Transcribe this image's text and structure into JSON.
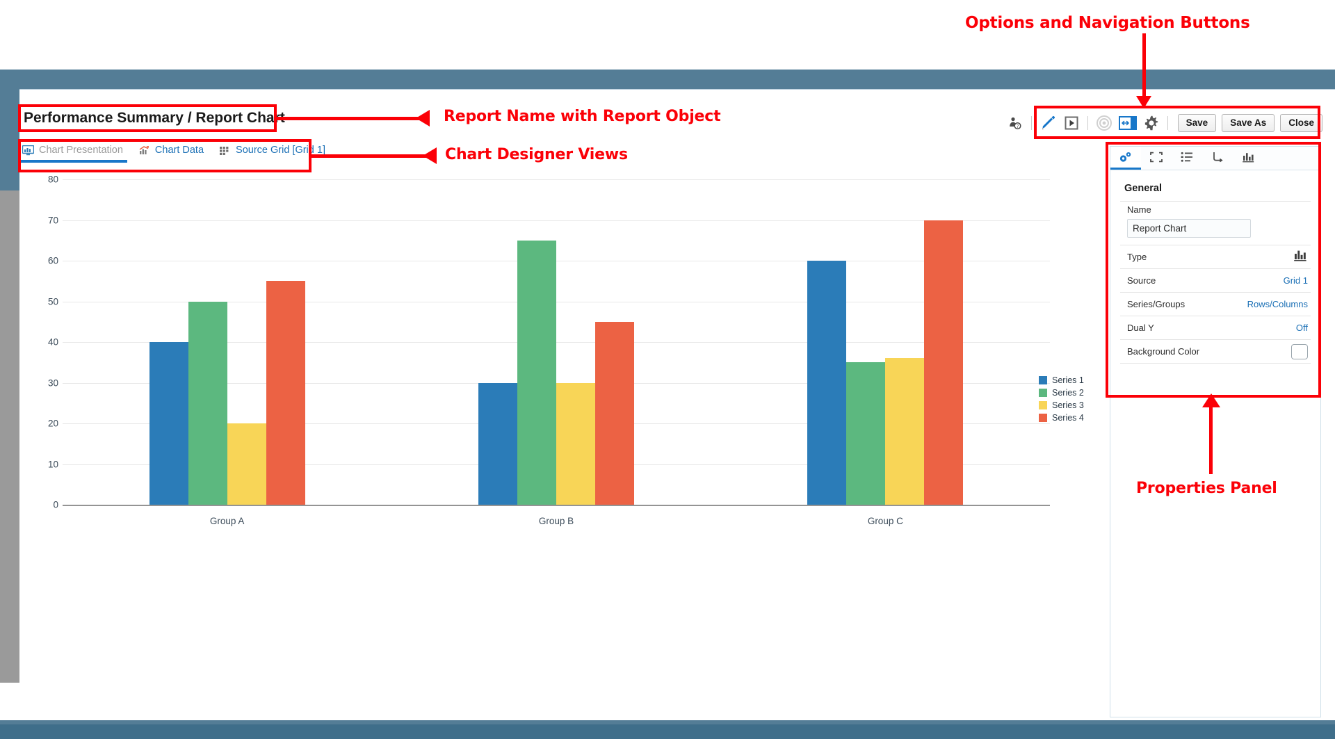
{
  "report": {
    "title": "Performance Summary / Report Chart"
  },
  "view_tabs": [
    {
      "label": "Chart Presentation",
      "icon": "chart-presentation-icon",
      "active": true
    },
    {
      "label": "Chart Data",
      "icon": "chart-data-icon",
      "active": false
    },
    {
      "label": "Source Grid [Grid 1]",
      "icon": "source-grid-icon",
      "active": false
    }
  ],
  "toolbar": {
    "icons": [
      {
        "name": "user-permissions-icon"
      },
      {
        "name": "edit-pencil-icon"
      },
      {
        "name": "run-play-icon"
      },
      {
        "name": "record-target-icon"
      },
      {
        "name": "resize-width-icon"
      },
      {
        "name": "settings-gear-icon"
      }
    ],
    "save_label": "Save",
    "save_as_label": "Save As",
    "close_label": "Close"
  },
  "properties": {
    "tabs": [
      {
        "name": "general-properties-tab",
        "icon": "gears-icon",
        "active": true
      },
      {
        "name": "layout-properties-tab",
        "icon": "expand-brackets-icon",
        "active": false
      },
      {
        "name": "legend-properties-tab",
        "icon": "list-icon",
        "active": false
      },
      {
        "name": "axis-properties-tab",
        "icon": "axis-arrow-icon",
        "active": false
      },
      {
        "name": "series-properties-tab",
        "icon": "bar-chart-icon",
        "active": false
      }
    ],
    "section_title": "General",
    "rows": {
      "name_label": "Name",
      "name_value": "Report Chart",
      "type_label": "Type",
      "type_value_icon": "bar-chart-icon",
      "source_label": "Source",
      "source_value": "Grid 1",
      "series_groups_label": "Series/Groups",
      "series_groups_value": "Rows/Columns",
      "dual_y_label": "Dual Y",
      "dual_y_value": "Off",
      "background_color_label": "Background Color",
      "background_color_value": "#ffffff"
    }
  },
  "annotations": [
    {
      "name": "annotation-options-nav",
      "text": "Options and Navigation Buttons"
    },
    {
      "name": "annotation-report-name",
      "text": "Report Name with Report Object"
    },
    {
      "name": "annotation-chart-views",
      "text": "Chart Designer Views"
    },
    {
      "name": "annotation-properties-panel",
      "text": "Properties Panel"
    }
  ],
  "chart_data": {
    "type": "bar",
    "title": "",
    "xlabel": "",
    "ylabel": "",
    "categories": [
      "Group A",
      "Group B",
      "Group C"
    ],
    "ylim": [
      0,
      80
    ],
    "yticks": [
      0,
      10,
      20,
      30,
      40,
      50,
      60,
      70,
      80
    ],
    "grid": true,
    "legend_position": "right",
    "series": [
      {
        "name": "Series 1",
        "color": "#2b7cb8",
        "values": [
          40,
          30,
          60
        ]
      },
      {
        "name": "Series 2",
        "color": "#5cb87f",
        "values": [
          50,
          65,
          35
        ]
      },
      {
        "name": "Series 3",
        "color": "#f8d557",
        "values": [
          20,
          30,
          36
        ]
      },
      {
        "name": "Series 4",
        "color": "#ec6244",
        "values": [
          55,
          45,
          70
        ]
      }
    ]
  }
}
